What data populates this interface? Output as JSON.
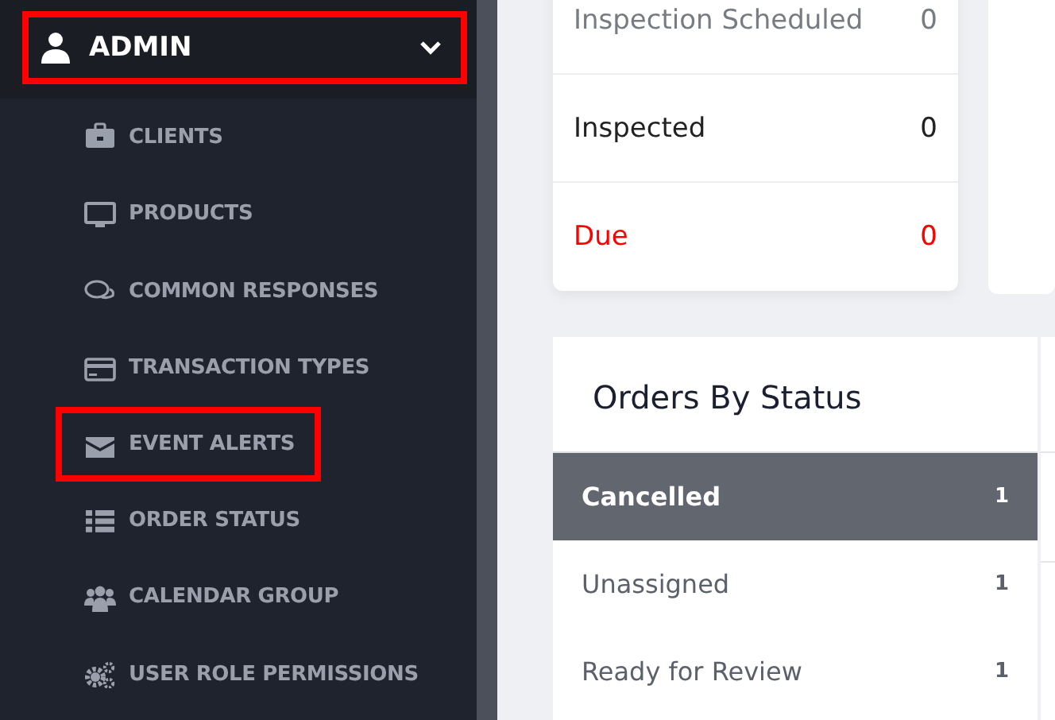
{
  "sidebar": {
    "header": {
      "label": "ADMIN",
      "expanded": true,
      "highlighted": true
    },
    "items": [
      {
        "label": "CLIENTS",
        "kind": "briefcase",
        "highlighted": false
      },
      {
        "label": "PRODUCTS",
        "kind": "monitor",
        "highlighted": false
      },
      {
        "label": "COMMON RESPONSES",
        "kind": "chat",
        "highlighted": false
      },
      {
        "label": "TRANSACTION TYPES",
        "kind": "card",
        "highlighted": false
      },
      {
        "label": "EVENT ALERTS",
        "kind": "envelope",
        "highlighted": true
      },
      {
        "label": "ORDER STATUS",
        "kind": "list",
        "highlighted": false
      },
      {
        "label": "CALENDAR GROUP",
        "kind": "users",
        "highlighted": false
      },
      {
        "label": "USER ROLE PERMISSIONS",
        "kind": "gears",
        "highlighted": false
      }
    ]
  },
  "summary": {
    "rows": [
      {
        "label": "Inspection Scheduled",
        "value": "0",
        "kind": "muted"
      },
      {
        "label": "Inspected",
        "value": "0",
        "kind": "normal"
      },
      {
        "label": "Due",
        "value": "0",
        "kind": "alert"
      }
    ]
  },
  "orders_by_status": {
    "title": "Orders By Status",
    "rows": [
      {
        "label": "Cancelled",
        "count": "1",
        "selected": true
      },
      {
        "label": "Unassigned",
        "count": "1",
        "selected": false
      },
      {
        "label": "Ready for Review",
        "count": "1",
        "selected": false
      }
    ]
  }
}
